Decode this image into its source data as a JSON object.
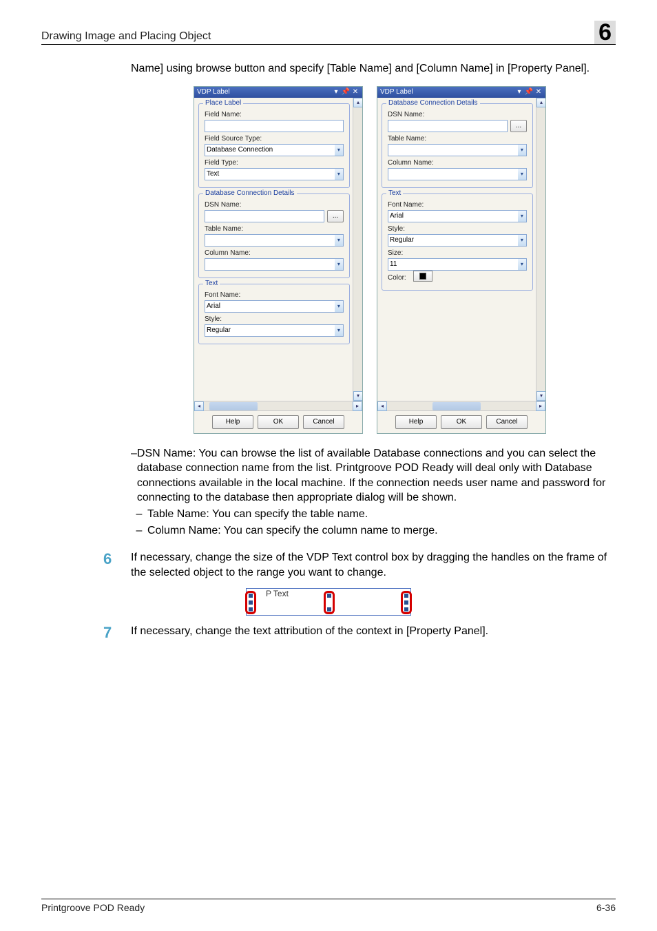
{
  "header": {
    "title": "Drawing Image and Placing Object",
    "chapter": "6"
  },
  "intro": "Name] using browse button and specify [Table Name] and [Column Name] in [Property Panel].",
  "panelLeft": {
    "title": "VDP Label",
    "placeLabel": {
      "legend": "Place Label",
      "fieldName_label": "Field Name:",
      "fieldName_value": "",
      "fieldSourceType_label": "Field Source Type:",
      "fieldSourceType_value": "Database Connection",
      "fieldType_label": "Field Type:",
      "fieldType_value": "Text"
    },
    "dbconn": {
      "legend": "Database Connection Details",
      "dsn_label": "DSN Name:",
      "dsn_value": "",
      "browse_label": "...",
      "table_label": "Table Name:",
      "table_value": "",
      "column_label": "Column Name:",
      "column_value": ""
    },
    "text": {
      "legend": "Text",
      "font_label": "Font Name:",
      "font_value": "Arial",
      "style_label": "Style:",
      "style_value": "Regular"
    },
    "buttons": {
      "help": "Help",
      "ok": "OK",
      "cancel": "Cancel"
    }
  },
  "panelRight": {
    "title": "VDP Label",
    "dbconn": {
      "legend": "Database Connection Details",
      "dsn_label": "DSN Name:",
      "dsn_value": "",
      "browse_label": "...",
      "table_label": "Table Name:",
      "table_value": "",
      "column_label": "Column Name:",
      "column_value": ""
    },
    "text": {
      "legend": "Text",
      "font_label": "Font Name:",
      "font_value": "Arial",
      "style_label": "Style:",
      "style_value": "Regular",
      "size_label": "Size:",
      "size_value": "11",
      "color_label": "Color:"
    },
    "buttons": {
      "help": "Help",
      "ok": "OK",
      "cancel": "Cancel"
    }
  },
  "bullets": {
    "dsn": "DSN Name: You can browse the list of available Database connections and you can select the database connection name from the list. Printgroove POD Ready will deal only with Database connections available in the local machine. If the connection needs user name and password for connecting to the database then appropriate dialog will be shown.",
    "table": "Table Name: You can specify the table name.",
    "column": "Column Name: You can specify the column name to merge."
  },
  "step6": {
    "num": "6",
    "text": "If necessary, change the size of the VDP Text control box by dragging the handles on the frame of the selected object to the range you want to change."
  },
  "fig": {
    "label": "P Text"
  },
  "step7": {
    "num": "7",
    "text": "If necessary, change the text attribution of the context in [Property Panel]."
  },
  "footer": {
    "product": "Printgroove POD Ready",
    "page": "6-36"
  }
}
